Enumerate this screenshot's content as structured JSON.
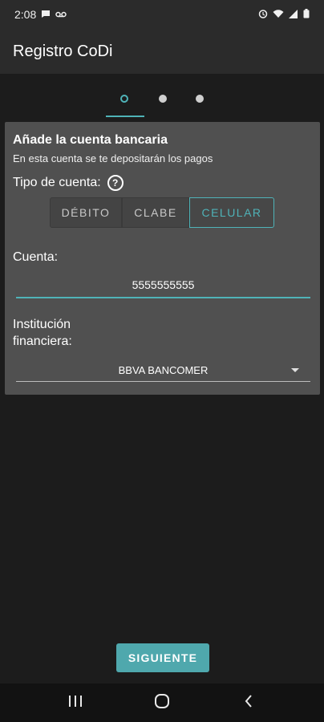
{
  "status_bar": {
    "time": "2:08",
    "left_icons": [
      "message-icon",
      "voicemail-icon"
    ],
    "right_icons": [
      "alarm-icon",
      "wifi-icon",
      "signal-icon",
      "battery-icon"
    ]
  },
  "app_bar": {
    "title": "Registro CoDi"
  },
  "pager": {
    "pages": 3,
    "active_index": 0
  },
  "card": {
    "title": "Añade la cuenta bancaria",
    "subtitle": "En esta cuenta se te depositarán los pagos",
    "tipo_label": "Tipo de cuenta:",
    "help_icon_glyph": "?",
    "account_types": [
      "DÉBITO",
      "CLABE",
      "CELULAR"
    ],
    "selected_type": "CELULAR",
    "cuenta_label": "Cuenta:",
    "cuenta_value": "5555555555",
    "institucion_label": "Institución financiera:",
    "institucion_value": "BBVA BANCOMER"
  },
  "actions": {
    "next_label": "SIGUIENTE"
  },
  "nav_bar": {
    "items": [
      "recents-icon",
      "home-icon",
      "back-icon"
    ]
  },
  "colors": {
    "accent": "#4fb3b8",
    "background": "#1c1c1c",
    "card": "#505050",
    "bar": "#2b2b2b"
  }
}
